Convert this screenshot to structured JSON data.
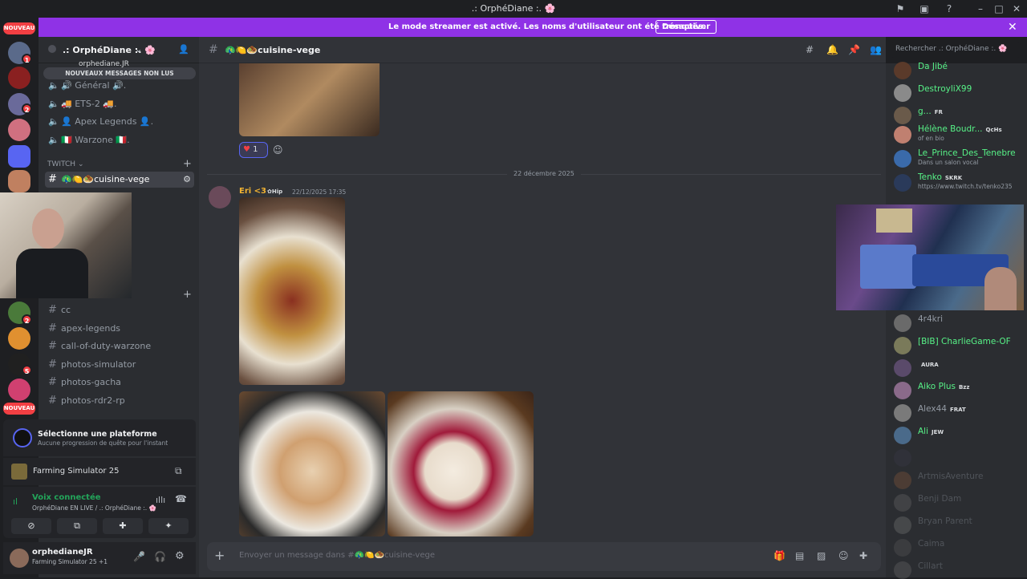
{
  "window": {
    "title": ".: OrphéDiane :. 🌸"
  },
  "streamer_bar": {
    "message": "Le mode streamer est activé. Les noms d'utilisateur ont été tronqués.",
    "button": "Désactiver"
  },
  "rail": {
    "new_label": "NOUVEAU",
    "badges": [
      "1",
      "2",
      "2",
      "5"
    ]
  },
  "server": {
    "name": ".: OrphéDiane :. 🌸"
  },
  "channels": {
    "new_messages_pill": "NOUVEAUX MESSAGES NON LUS",
    "partial_user": "orphediane.JR",
    "voice": [
      {
        "label": "🔊 Général 🔊."
      },
      {
        "label": "🚚 ETS-2 🚚."
      },
      {
        "label": "👤 Apex Legends 👤."
      },
      {
        "label": "🇮🇹 Warzone 🇮🇹."
      }
    ],
    "twitch_category": "TWITCH",
    "active_channel": "🦚🍋🧆cuisine-vege",
    "text": [
      {
        "label": "cc"
      },
      {
        "label": "apex-legends"
      },
      {
        "label": "call-of-duty-warzone"
      },
      {
        "label": "photos-simulator"
      },
      {
        "label": "photos-gacha"
      },
      {
        "label": "photos-rdr2-rp"
      }
    ]
  },
  "quest": {
    "title": "Sélectionne une plateforme",
    "subtitle": "Aucune progression de quête pour l'instant"
  },
  "game": {
    "name": "Farming Simulator 25"
  },
  "voice": {
    "status": "Voix connectée",
    "detail": "OrphéDiane EN LIVE / .: OrphéDiane :. 🌸"
  },
  "user": {
    "name": "orphedianeJR",
    "activity": "Farming Simulator 25 +1"
  },
  "chat": {
    "channel_name": "🦚🍋🧆cuisine-vege",
    "reaction_count": "1",
    "date_divider": "22 décembre 2025",
    "message": {
      "author": "Eri <3",
      "badge": "Hip",
      "timestamp": "22/12/2025 17:35"
    },
    "composer_placeholder": "Envoyer un message dans #🦚🍋🧆cuisine-vege"
  },
  "search": {
    "placeholder": "Rechercher .: OrphéDiane :. 🌸"
  },
  "members": [
    {
      "name": "Da Jibé",
      "color": "#57f287",
      "tag": "",
      "sub": ""
    },
    {
      "name": "DestroyliX99",
      "color": "#57f287",
      "tag": "",
      "sub": ""
    },
    {
      "name": "g...",
      "color": "#57f287",
      "tag": "FR",
      "sub": ""
    },
    {
      "name": "Hélène Boudr...",
      "color": "#57f287",
      "tag": "QcHs",
      "sub": "of en bio"
    },
    {
      "name": "Le_Prince_Des_Tenebre",
      "color": "#57f287",
      "tag": "",
      "sub": "Dans un salon vocal"
    },
    {
      "name": "Tenko",
      "color": "#57f287",
      "tag": "SKRK",
      "sub": "https://www.twitch.tv/tenko235"
    },
    {
      "name": "4r4kri",
      "color": "#949ba4",
      "tag": "",
      "sub": ""
    },
    {
      "name": "[BIB] CharlieGame-OF",
      "color": "#57f287",
      "tag": "",
      "sub": ""
    },
    {
      "name": "",
      "color": "#949ba4",
      "tag": "AURA",
      "sub": ""
    },
    {
      "name": "Aiko Plus",
      "color": "#57f287",
      "tag": "Bzz",
      "sub": ""
    },
    {
      "name": "Alex44",
      "color": "#949ba4",
      "tag": "FRAT",
      "sub": ""
    },
    {
      "name": "Ali",
      "color": "#57f287",
      "tag": "JEW",
      "sub": ""
    },
    {
      "name": "",
      "color": "#949ba4",
      "tag": "",
      "sub": ""
    },
    {
      "name": "ArtmisAventure",
      "color": "#949ba4",
      "tag": "",
      "sub": ""
    },
    {
      "name": "Benji Dam",
      "color": "#949ba4",
      "tag": "",
      "sub": ""
    },
    {
      "name": "Bryan Parent",
      "color": "#949ba4",
      "tag": "",
      "sub": ""
    },
    {
      "name": "Caima",
      "color": "#949ba4",
      "tag": "",
      "sub": ""
    },
    {
      "name": "Cillart",
      "color": "#949ba4",
      "tag": "",
      "sub": ""
    }
  ]
}
